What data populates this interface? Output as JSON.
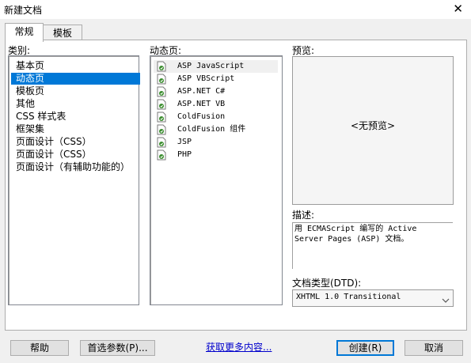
{
  "window": {
    "title": "新建文档",
    "close_glyph": "✕"
  },
  "tabs": [
    {
      "label": "常规",
      "active": true
    },
    {
      "label": "模板",
      "active": false
    }
  ],
  "category": {
    "label": "类别:",
    "items": [
      {
        "label": "基本页"
      },
      {
        "label": "动态页",
        "selected": true
      },
      {
        "label": "模板页"
      },
      {
        "label": "其他"
      },
      {
        "label": "CSS 样式表"
      },
      {
        "label": "框架集"
      },
      {
        "label": "页面设计（CSS）"
      },
      {
        "label": "页面设计（CSS）"
      },
      {
        "label": "页面设计（有辅助功能的）"
      }
    ]
  },
  "dynamic_pages": {
    "label": "动态页:",
    "items": [
      {
        "label": "ASP JavaScript",
        "icon": "dynamic-page-icon",
        "selected": true
      },
      {
        "label": "ASP VBScript",
        "icon": "dynamic-page-icon"
      },
      {
        "label": "ASP.NET C#",
        "icon": "dynamic-page-icon"
      },
      {
        "label": "ASP.NET VB",
        "icon": "dynamic-page-icon"
      },
      {
        "label": "ColdFusion",
        "icon": "dynamic-page-icon"
      },
      {
        "label": "ColdFusion 组件",
        "icon": "dynamic-page-icon"
      },
      {
        "label": "JSP",
        "icon": "dynamic-page-icon"
      },
      {
        "label": "PHP",
        "icon": "dynamic-page-icon"
      }
    ]
  },
  "preview": {
    "label": "预览:",
    "text": "<无预览>"
  },
  "description": {
    "label": "描述:",
    "text": "用 ECMAScript 编写的 Active Server Pages (ASP) 文档。"
  },
  "doctype": {
    "label": "文档类型(DTD):",
    "value": "XHTML 1.0 Transitional"
  },
  "buttons": {
    "help": "帮助",
    "preferences": "首选参数(P)...",
    "more_content": "获取更多内容...",
    "create": "创建(R)",
    "cancel": "取消"
  },
  "colors": {
    "selection": "#0078d7",
    "link": "#0000cc",
    "icon_green": "#3b8d2f"
  }
}
